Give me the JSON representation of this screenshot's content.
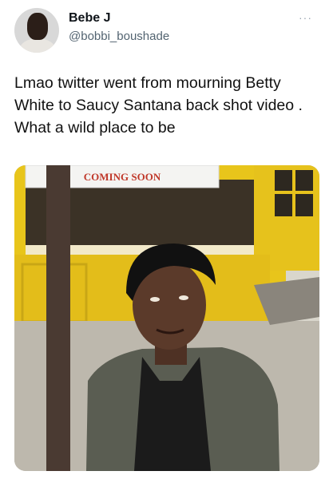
{
  "tweet": {
    "display_name": "Bebe J",
    "handle": "@bobbi_boushade",
    "more_glyph": "···",
    "text": "Lmao twitter went from mourning Betty White to Saucy Santana back shot video . What a wild place to be"
  },
  "media": {
    "sign_text": "COMING SOON",
    "colors": {
      "storefront_yellow": "#e8c51b",
      "sign_red": "#c0392b",
      "jacket": "#5a5d52",
      "shirt": "#1b1b1b",
      "skin": "#5b3a2a",
      "hair": "#111111",
      "pole": "#4a3a32",
      "sidewalk": "#bdb8ad"
    }
  }
}
